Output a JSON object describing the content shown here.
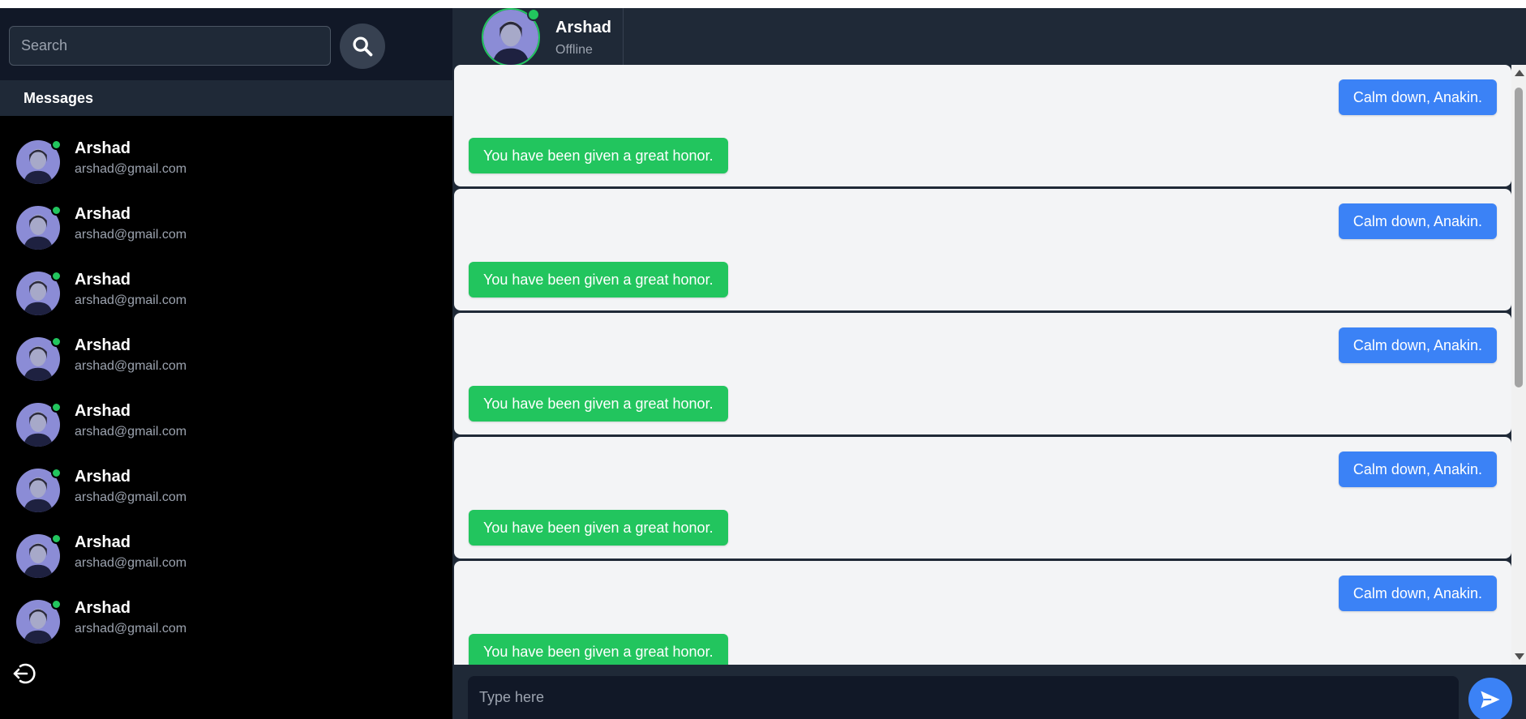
{
  "sidebar": {
    "search": {
      "placeholder": "Search"
    },
    "messages_header": "Messages",
    "contacts": [
      {
        "name": "Arshad",
        "email": "arshad@gmail.com",
        "online": true
      },
      {
        "name": "Arshad",
        "email": "arshad@gmail.com",
        "online": true
      },
      {
        "name": "Arshad",
        "email": "arshad@gmail.com",
        "online": true
      },
      {
        "name": "Arshad",
        "email": "arshad@gmail.com",
        "online": true
      },
      {
        "name": "Arshad",
        "email": "arshad@gmail.com",
        "online": true
      },
      {
        "name": "Arshad",
        "email": "arshad@gmail.com",
        "online": true
      },
      {
        "name": "Arshad",
        "email": "arshad@gmail.com",
        "online": true
      },
      {
        "name": "Arshad",
        "email": "arshad@gmail.com",
        "online": true
      }
    ]
  },
  "chat": {
    "header": {
      "name": "Arshad",
      "status": "Offline"
    },
    "messages": [
      {
        "sent": "Calm down, Anakin.",
        "received": "You have been given a great honor."
      },
      {
        "sent": "Calm down, Anakin.",
        "received": "You have been given a great honor."
      },
      {
        "sent": "Calm down, Anakin.",
        "received": "You have been given a great honor."
      },
      {
        "sent": "Calm down, Anakin.",
        "received": "You have been given a great honor."
      },
      {
        "sent": "Calm down, Anakin.",
        "received": "You have been given a great honor."
      }
    ],
    "composer": {
      "placeholder": "Type here"
    }
  },
  "icons": {
    "search": "search-icon",
    "logout": "logout-icon",
    "send": "send-icon"
  },
  "colors": {
    "sent_bubble": "#3b82f6",
    "received_bubble": "#22c55e",
    "online_dot": "#22c55e"
  }
}
